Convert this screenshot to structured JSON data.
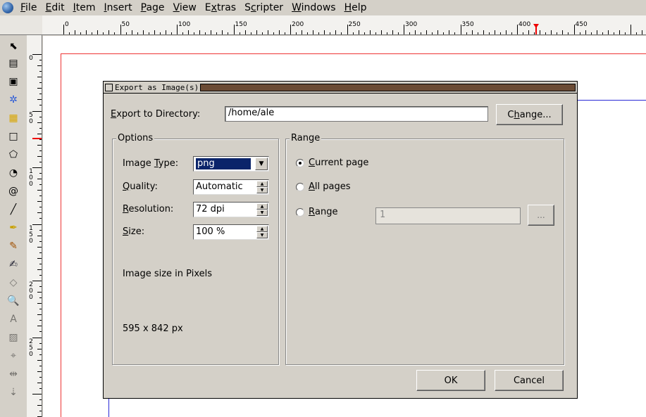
{
  "menubar": {
    "items": [
      {
        "label": "File",
        "mn": "F",
        "rest": "ile"
      },
      {
        "label": "Edit",
        "mn": "E",
        "rest": "dit"
      },
      {
        "label": "Item",
        "mn": "I",
        "rest": "tem"
      },
      {
        "label": "Insert",
        "mn": "I",
        "rest": "nsert"
      },
      {
        "label": "Page",
        "mn": "P",
        "rest": "age"
      },
      {
        "label": "View",
        "mn": "V",
        "rest": "iew"
      },
      {
        "label": "Extras",
        "pre": "E",
        "mn": "x",
        "rest": "tras"
      },
      {
        "label": "Scripter",
        "pre": "S",
        "mn": "c",
        "rest": "ripter"
      },
      {
        "label": "Windows",
        "mn": "W",
        "rest": "indows"
      },
      {
        "label": "Help",
        "mn": "H",
        "rest": "elp"
      }
    ]
  },
  "ruler": {
    "h_labels": [
      "0",
      "50",
      "100",
      "150",
      "200",
      "250",
      "300",
      "350",
      "400",
      "450"
    ],
    "v_labels": [
      "0",
      "50",
      "100",
      "150",
      "200",
      "250"
    ]
  },
  "dialog": {
    "title": "Export as Image(s)",
    "export_dir_label_pre": "E",
    "export_dir_label_rest": "xport to Directory:",
    "export_dir_value": "/home/ale",
    "change_pre": "C",
    "change_mn": "h",
    "change_rest": "ange...",
    "options": {
      "title": "Options",
      "image_type_label_pre": "Image ",
      "image_type_label_mn": "T",
      "image_type_label_rest": "ype:",
      "image_type_value": "png",
      "quality_label_mn": "Q",
      "quality_label_rest": "uality:",
      "quality_value": "Automatic",
      "resolution_label_mn": "R",
      "resolution_label_rest": "esolution:",
      "resolution_value": "72 dpi",
      "size_label_mn": "S",
      "size_label_rest": "ize:",
      "size_value": "100 %",
      "image_size_caption": "Image size in Pixels",
      "image_size_value": "595 x 842 px"
    },
    "range": {
      "title": "Range",
      "current_page_mn": "C",
      "current_page_rest": "urrent page",
      "all_pages_mn": "A",
      "all_pages_rest": "ll pages",
      "range_mn": "R",
      "range_rest": "ange",
      "range_value": "1",
      "ellipsis": "..."
    },
    "ok": "OK",
    "cancel": "Cancel"
  }
}
